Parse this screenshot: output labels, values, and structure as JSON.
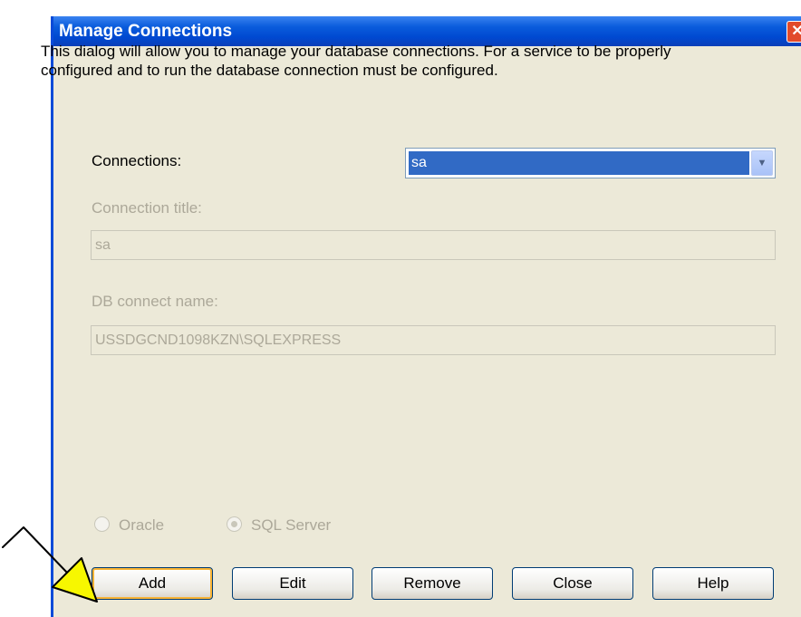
{
  "window": {
    "title": "Manage Connections",
    "close_glyph": "✕"
  },
  "description": "This dialog will allow you to manage your database connections. For a service to be properly configured and to run the database connection must be configured.",
  "connections": {
    "label": "Connections:",
    "selected": "sa",
    "arrow_glyph": "▼"
  },
  "connection_title": {
    "label": "Connection title:",
    "value": "sa"
  },
  "db_connect_name": {
    "label": "DB connect name:",
    "value": "USSDGCND1098KZN\\SQLEXPRESS"
  },
  "db_type": {
    "options": [
      "Oracle",
      "SQL Server"
    ],
    "selected": "SQL Server"
  },
  "buttons": {
    "add": "Add",
    "edit": "Edit",
    "remove": "Remove",
    "close": "Close",
    "help": "Help"
  },
  "colors": {
    "annotation_arrow_fill": "#f7f700",
    "annotation_arrow_stroke": "#000000",
    "selection": "#316ac5",
    "titlebar": "#0a5cdc"
  }
}
